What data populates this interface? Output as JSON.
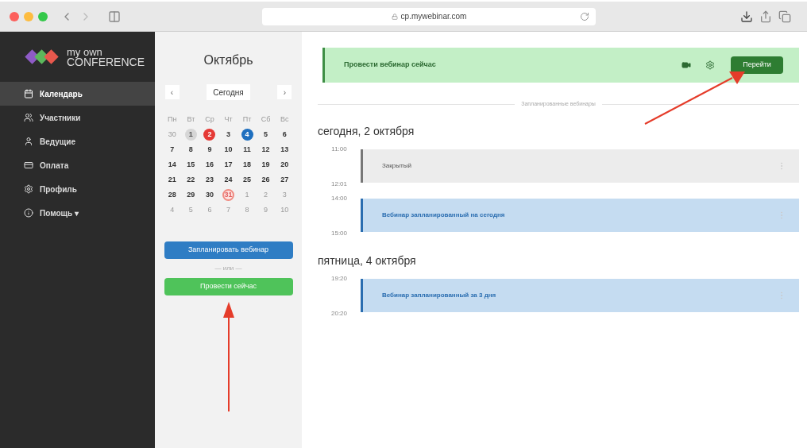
{
  "browser": {
    "url": "cp.mywebinar.com"
  },
  "logo": {
    "line1": "my own",
    "line2": "CONFERENCE"
  },
  "sidebar": {
    "items": [
      {
        "label": "Календарь",
        "selected": true
      },
      {
        "label": "Участники",
        "selected": false
      },
      {
        "label": "Ведущие",
        "selected": false
      },
      {
        "label": "Оплата",
        "selected": false
      },
      {
        "label": "Профиль",
        "selected": false
      },
      {
        "label": "Помощь ▾",
        "selected": false
      }
    ]
  },
  "calendar": {
    "month": "Октябрь",
    "today_button": "Сегодня",
    "prev": "‹",
    "next": "›",
    "weekdays": [
      "Пн",
      "Вт",
      "Ср",
      "Чт",
      "Пт",
      "Сб",
      "Вс"
    ],
    "weeks": [
      [
        {
          "d": "30",
          "kind": "other"
        },
        {
          "d": "1",
          "kind": "past"
        },
        {
          "d": "2",
          "kind": "today"
        },
        {
          "d": "3",
          "kind": "normal"
        },
        {
          "d": "4",
          "kind": "selected"
        },
        {
          "d": "5",
          "kind": "normal"
        },
        {
          "d": "6",
          "kind": "normal"
        }
      ],
      [
        {
          "d": "7",
          "kind": "normal"
        },
        {
          "d": "8",
          "kind": "normal"
        },
        {
          "d": "9",
          "kind": "normal"
        },
        {
          "d": "10",
          "kind": "normal"
        },
        {
          "d": "11",
          "kind": "normal"
        },
        {
          "d": "12",
          "kind": "normal"
        },
        {
          "d": "13",
          "kind": "normal"
        }
      ],
      [
        {
          "d": "14",
          "kind": "normal"
        },
        {
          "d": "15",
          "kind": "normal"
        },
        {
          "d": "16",
          "kind": "normal"
        },
        {
          "d": "17",
          "kind": "normal"
        },
        {
          "d": "18",
          "kind": "normal"
        },
        {
          "d": "19",
          "kind": "normal"
        },
        {
          "d": "20",
          "kind": "normal"
        }
      ],
      [
        {
          "d": "21",
          "kind": "normal"
        },
        {
          "d": "22",
          "kind": "normal"
        },
        {
          "d": "23",
          "kind": "normal"
        },
        {
          "d": "24",
          "kind": "normal"
        },
        {
          "d": "25",
          "kind": "normal"
        },
        {
          "d": "26",
          "kind": "normal"
        },
        {
          "d": "27",
          "kind": "normal"
        }
      ],
      [
        {
          "d": "28",
          "kind": "normal"
        },
        {
          "d": "29",
          "kind": "normal"
        },
        {
          "d": "30",
          "kind": "normal"
        },
        {
          "d": "31",
          "kind": "outlined"
        },
        {
          "d": "1",
          "kind": "other"
        },
        {
          "d": "2",
          "kind": "other"
        },
        {
          "d": "3",
          "kind": "other"
        }
      ],
      [
        {
          "d": "4",
          "kind": "other"
        },
        {
          "d": "5",
          "kind": "other"
        },
        {
          "d": "6",
          "kind": "other"
        },
        {
          "d": "7",
          "kind": "other"
        },
        {
          "d": "8",
          "kind": "other"
        },
        {
          "d": "9",
          "kind": "other"
        },
        {
          "d": "10",
          "kind": "other"
        }
      ]
    ],
    "schedule_button": "Запланировать вебинар",
    "or": "— или —",
    "now_button": "Провести сейчас"
  },
  "banner": {
    "text": "Провести вебинар сейчас",
    "button": "Перейти"
  },
  "divider_label": "Запланированные вебинары",
  "days": [
    {
      "title": "сегодня, 2 октября",
      "events": [
        {
          "start": "11:00",
          "end": "12:01",
          "title": "Закрытый",
          "kind": "closed"
        },
        {
          "start": "14:00",
          "end": "15:00",
          "title": "Вебинар запланированный на сегодня",
          "kind": "planned"
        }
      ]
    },
    {
      "title": "пятница, 4 октября",
      "events": [
        {
          "start": "19:20",
          "end": "20:20",
          "title": "Вебинар запланированный за 3 дня",
          "kind": "planned"
        }
      ]
    }
  ]
}
